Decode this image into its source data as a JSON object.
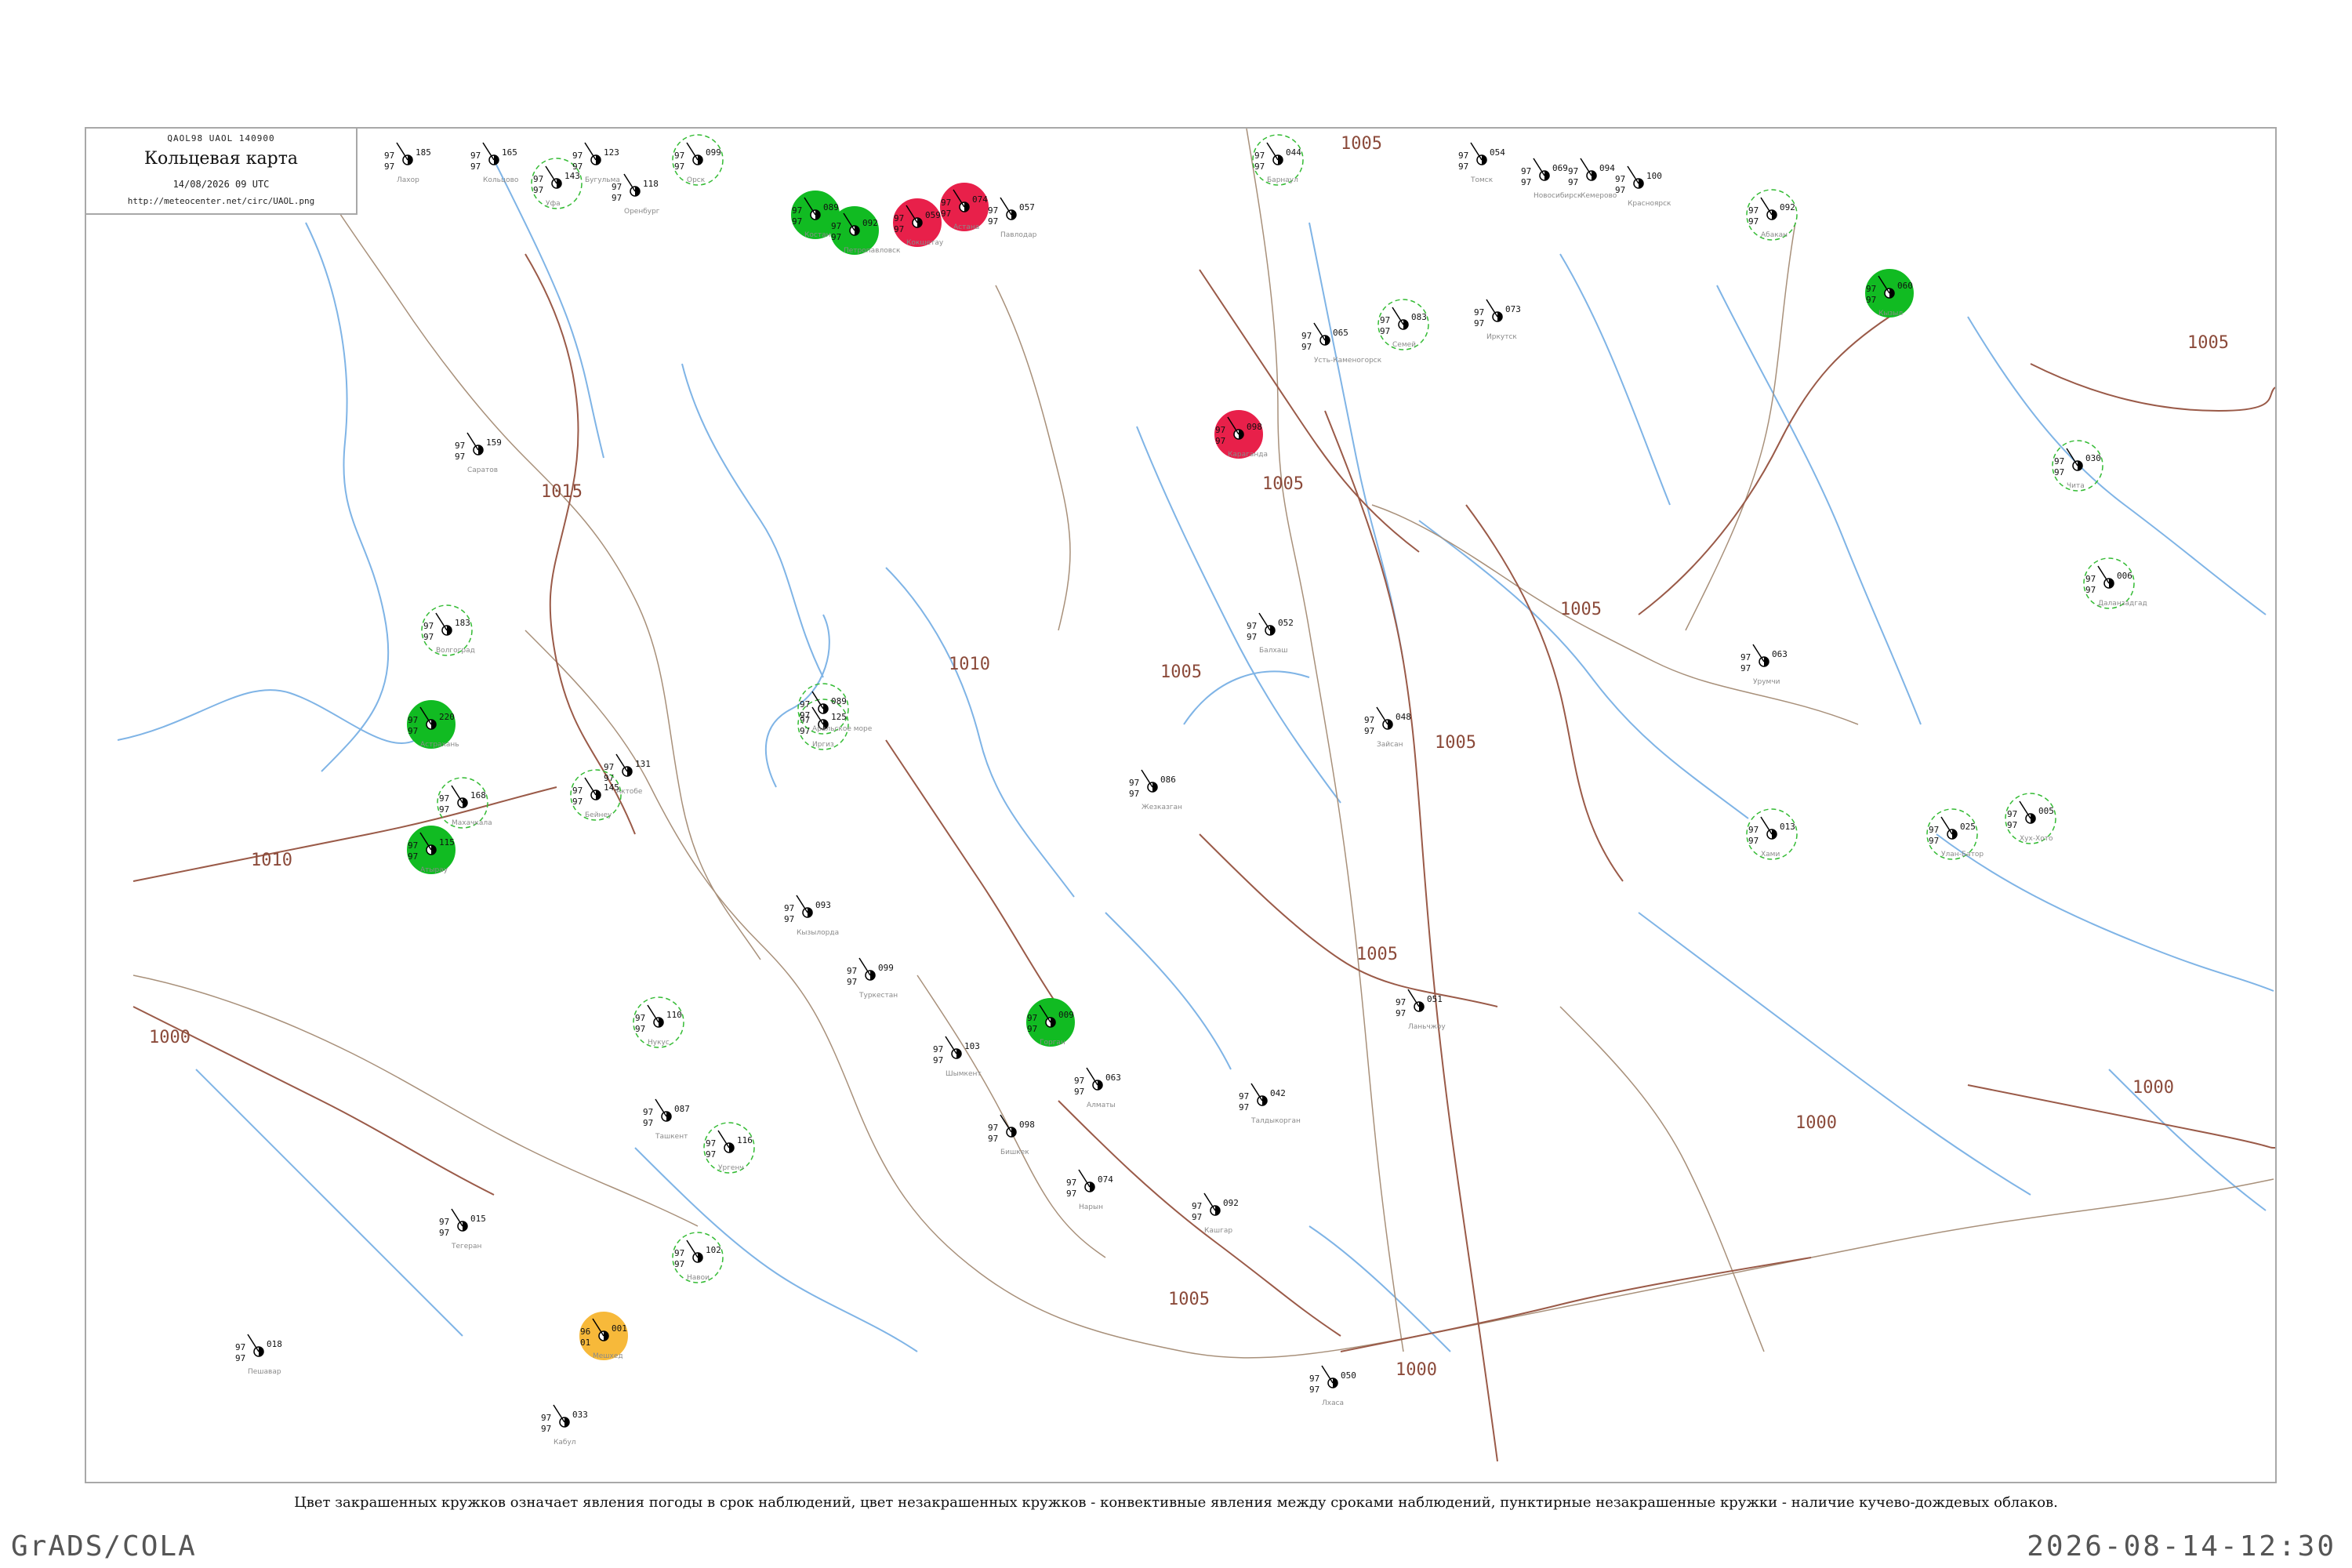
{
  "header": {
    "codes": "QAOL98  UAOL  140900",
    "title": "Кольцевая карта",
    "datetime": "14/08/2026 09 UTC",
    "url": "http://meteocenter.net/circ/UAOL.png"
  },
  "legend_note": "Цвет закрашенных кружков означает явления погоды в срок наблюдений, цвет незакрашенных кружков - конвективные явления между сроками наблюдений, пунктирные незакрашенные кружки - наличие кучево-дождевых облаков.",
  "footer": {
    "left": "GrADS/COLA",
    "right": "2026-08-14-12:30"
  },
  "colors": {
    "rain": "#11bb22",
    "thunder": "#e8204a",
    "dust": "#f7b93a",
    "cb_ring": "#33bb33",
    "isobar": "#9a5a48",
    "river": "#7fb4e6"
  },
  "isobars": [
    "1015",
    "1010",
    "1005",
    "1000"
  ],
  "stations": [
    {
      "pressure": "185",
      "temp": "97",
      "dew": "97",
      "name": "Лахор",
      "type": "plain"
    },
    {
      "pressure": "165",
      "temp": "97",
      "dew": "97",
      "name": "Кольцово",
      "type": "plain"
    },
    {
      "pressure": "143",
      "temp": "97",
      "dew": "97",
      "name": "Уфа",
      "type": "cb"
    },
    {
      "pressure": "123",
      "temp": "97",
      "dew": "97",
      "name": "Бугульма",
      "type": "plain"
    },
    {
      "pressure": "118",
      "temp": "97",
      "dew": "97",
      "name": "Оренбург",
      "type": "plain"
    },
    {
      "pressure": "099",
      "temp": "97",
      "dew": "97",
      "name": "Орск",
      "type": "cb"
    },
    {
      "pressure": "089",
      "temp": "97",
      "dew": "97",
      "name": "Костанай",
      "type": "rain"
    },
    {
      "pressure": "092",
      "temp": "97",
      "dew": "97",
      "name": "Петропавловск",
      "type": "rain"
    },
    {
      "pressure": "059",
      "temp": "97",
      "dew": "97",
      "name": "Кокшетау",
      "type": "thunder"
    },
    {
      "pressure": "074",
      "temp": "97",
      "dew": "97",
      "name": "Астана",
      "type": "thunder"
    },
    {
      "pressure": "057",
      "temp": "97",
      "dew": "97",
      "name": "Павлодар",
      "type": "plain"
    },
    {
      "pressure": "044",
      "temp": "97",
      "dew": "97",
      "name": "Барнаул",
      "type": "cb"
    },
    {
      "pressure": "054",
      "temp": "97",
      "dew": "97",
      "name": "Томск",
      "type": "plain"
    },
    {
      "pressure": "069",
      "temp": "97",
      "dew": "97",
      "name": "Новосибирск",
      "type": "plain"
    },
    {
      "pressure": "094",
      "temp": "97",
      "dew": "97",
      "name": "Кемерово",
      "type": "plain"
    },
    {
      "pressure": "100",
      "temp": "97",
      "dew": "97",
      "name": "Красноярск",
      "type": "plain"
    },
    {
      "pressure": "092",
      "temp": "97",
      "dew": "97",
      "name": "Абакан",
      "type": "cb"
    },
    {
      "pressure": "060",
      "temp": "97",
      "dew": "97",
      "name": "Кызыл",
      "type": "rain"
    },
    {
      "pressure": "065",
      "temp": "97",
      "dew": "97",
      "name": "Усть-Каменогорск",
      "type": "plain"
    },
    {
      "pressure": "083",
      "temp": "97",
      "dew": "97",
      "name": "Семей",
      "type": "cb"
    },
    {
      "pressure": "098",
      "temp": "97",
      "dew": "97",
      "name": "Караганда",
      "type": "thunder"
    },
    {
      "pressure": "159",
      "temp": "97",
      "dew": "97",
      "name": "Саратов",
      "type": "plain"
    },
    {
      "pressure": "183",
      "temp": "97",
      "dew": "97",
      "name": "Волгоград",
      "type": "cb"
    },
    {
      "pressure": "220",
      "temp": "97",
      "dew": "97",
      "name": "Астрахань",
      "type": "rain"
    },
    {
      "pressure": "168",
      "temp": "97",
      "dew": "97",
      "name": "Махачкала",
      "type": "cb"
    },
    {
      "pressure": "115",
      "temp": "97",
      "dew": "97",
      "name": "Атырау",
      "type": "rain"
    },
    {
      "pressure": "131",
      "temp": "97",
      "dew": "97",
      "name": "Актобе",
      "type": "plain"
    },
    {
      "pressure": "125",
      "temp": "97",
      "dew": "97",
      "name": "Иргиз",
      "type": "cb"
    },
    {
      "pressure": "086",
      "temp": "97",
      "dew": "97",
      "name": "Жезказган",
      "type": "plain"
    },
    {
      "pressure": "052",
      "temp": "97",
      "dew": "97",
      "name": "Балхаш",
      "type": "plain"
    },
    {
      "pressure": "048",
      "temp": "97",
      "dew": "97",
      "name": "Зайсан",
      "type": "plain"
    },
    {
      "pressure": "089",
      "temp": "97",
      "dew": "97",
      "name": "Аральское море",
      "type": "cb"
    },
    {
      "pressure": "145",
      "temp": "97",
      "dew": "97",
      "name": "Бейнеу",
      "type": "cb"
    },
    {
      "pressure": "093",
      "temp": "97",
      "dew": "97",
      "name": "Кызылорда",
      "type": "plain"
    },
    {
      "pressure": "099",
      "temp": "97",
      "dew": "97",
      "name": "Туркестан",
      "type": "plain"
    },
    {
      "pressure": "103",
      "temp": "97",
      "dew": "97",
      "name": "Шымкент",
      "type": "plain"
    },
    {
      "pressure": "063",
      "temp": "97",
      "dew": "97",
      "name": "Алматы",
      "type": "plain"
    },
    {
      "pressure": "042",
      "temp": "97",
      "dew": "97",
      "name": "Талдыкорган",
      "type": "plain"
    },
    {
      "pressure": "110",
      "temp": "97",
      "dew": "97",
      "name": "Нукус",
      "type": "cb"
    },
    {
      "pressure": "116",
      "temp": "97",
      "dew": "97",
      "name": "Ургенч",
      "type": "cb"
    },
    {
      "pressure": "102",
      "temp": "97",
      "dew": "97",
      "name": "Навои",
      "type": "cb"
    },
    {
      "pressure": "087",
      "temp": "97",
      "dew": "97",
      "name": "Ташкент",
      "type": "plain"
    },
    {
      "pressure": "098",
      "temp": "97",
      "dew": "97",
      "name": "Бишкек",
      "type": "plain"
    },
    {
      "pressure": "074",
      "temp": "97",
      "dew": "97",
      "name": "Нарын",
      "type": "plain"
    },
    {
      "pressure": "092",
      "temp": "97",
      "dew": "97",
      "name": "Кашгар",
      "type": "plain"
    },
    {
      "pressure": "009",
      "temp": "97",
      "dew": "97",
      "name": "Горган",
      "type": "rain"
    },
    {
      "pressure": "001",
      "temp": "96",
      "dew": "01",
      "name": "Мешхед",
      "type": "dust"
    },
    {
      "pressure": "033",
      "temp": "97",
      "dew": "97",
      "name": "Кабул",
      "type": "plain"
    },
    {
      "pressure": "018",
      "temp": "97",
      "dew": "97",
      "name": "Пешавар",
      "type": "plain"
    },
    {
      "pressure": "015",
      "temp": "97",
      "dew": "97",
      "name": "Тегеран",
      "type": "plain"
    },
    {
      "pressure": "063",
      "temp": "97",
      "dew": "97",
      "name": "Урумчи",
      "type": "plain"
    },
    {
      "pressure": "013",
      "temp": "97",
      "dew": "97",
      "name": "Хами",
      "type": "cb"
    },
    {
      "pressure": "025",
      "temp": "97",
      "dew": "97",
      "name": "Улан-Батор",
      "type": "cb"
    },
    {
      "pressure": "005",
      "temp": "97",
      "dew": "97",
      "name": "Хух-Хото",
      "type": "cb"
    },
    {
      "pressure": "006",
      "temp": "97",
      "dew": "97",
      "name": "Даланзадгад",
      "type": "cb"
    },
    {
      "pressure": "030",
      "temp": "97",
      "dew": "97",
      "name": "Чита",
      "type": "cb"
    },
    {
      "pressure": "073",
      "temp": "97",
      "dew": "97",
      "name": "Иркутск",
      "type": "plain"
    },
    {
      "pressure": "051",
      "temp": "97",
      "dew": "97",
      "name": "Ланьчжоу",
      "type": "plain"
    },
    {
      "pressure": "050",
      "temp": "97",
      "dew": "97",
      "name": "Лхаса",
      "type": "plain"
    }
  ]
}
